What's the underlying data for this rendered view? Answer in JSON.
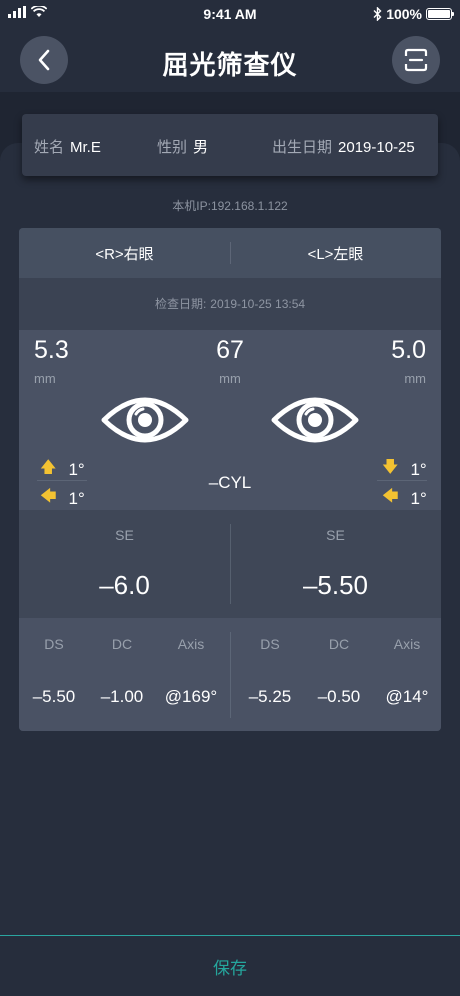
{
  "status_bar": {
    "time": "9:41 AM",
    "battery": "100%"
  },
  "nav": {
    "title": "屈光筛查仪"
  },
  "patient": {
    "name_label": "姓名",
    "name_value": "Mr.E",
    "gender_label": "性别",
    "gender_value": "男",
    "birth_label": "出生日期",
    "birth_value": "2019-10-25"
  },
  "device": {
    "ip": "本机IP:192.168.1.122"
  },
  "tabs": {
    "right": "<R>右眼",
    "left": "<L>左眼"
  },
  "exam": {
    "date_label": "检查日期:",
    "date_value": "2019-10-25 13:54"
  },
  "measure": {
    "right_pupil": "5.3",
    "right_unit": "mm",
    "distance": "67",
    "distance_unit": "mm",
    "left_pupil": "5.0",
    "left_unit": "mm",
    "right_tilt_up": "1°",
    "right_tilt_side": "1°",
    "left_tilt_down": "1°",
    "left_tilt_side": "1°",
    "cyl_mode": "–CYL"
  },
  "se": {
    "right_label": "SE",
    "right_value": "–6.0",
    "left_label": "SE",
    "left_value": "–5.50"
  },
  "rx": {
    "headers": [
      "DS",
      "DC",
      "Axis"
    ],
    "right": {
      "ds": "–5.50",
      "dc": "–1.00",
      "axis": "@169°"
    },
    "left": {
      "ds": "–5.25",
      "dc": "–0.50",
      "axis": "@14°"
    }
  },
  "footer": {
    "save_label": "保存"
  },
  "colors": {
    "accent": "#25a69d",
    "arrow": "#f3c232",
    "background": "#262d3c"
  }
}
